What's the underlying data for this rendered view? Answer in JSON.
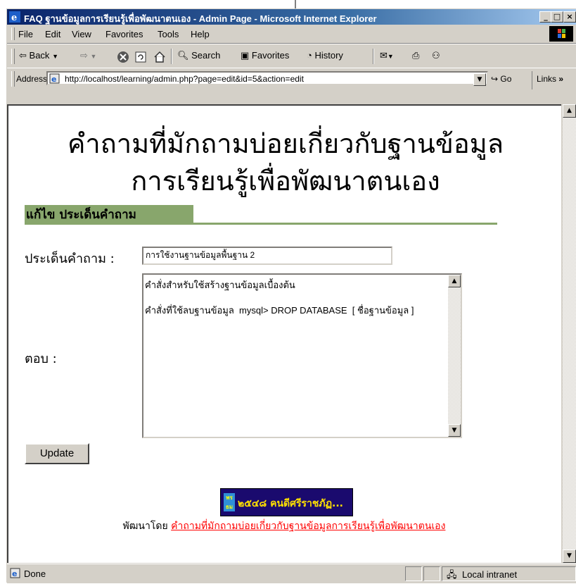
{
  "window": {
    "title": "FAQ ฐานข้อมูลการเรียนรู้เพื่อพัฒนาตนเอง - Admin Page - Microsoft Internet Explorer",
    "buttons": [
      "_",
      "□",
      "×"
    ]
  },
  "menu": {
    "items": [
      "File",
      "Edit",
      "View",
      "Favorites",
      "Tools",
      "Help"
    ]
  },
  "toolbar": {
    "back": "Back",
    "search": "Search",
    "favorites": "Favorites",
    "history": "History"
  },
  "address": {
    "label": "Address",
    "url": "http://localhost/learning/admin.php?page=edit&id=5&action=edit",
    "go": "Go",
    "links": "Links"
  },
  "page": {
    "title_line1": "คำถามที่มักถามบ่อยเกี่ยวกับฐานข้อมูล",
    "title_line2": "การเรียนรู้เพื่อพัฒนาตนเอง",
    "section": "แก้ไข ประเด็นคำถาม",
    "topic_label": "ประเด็นคำถาม :",
    "topic_value": "การใช้งานฐานข้อมูลพื้นฐาน 2",
    "answer_label": "ตอบ :",
    "answer_value": "คำสั่งสำหรับใช้สร้างฐานข้อมูลเบื้องต้น\n\nคำสั่งที่ใช้ลบฐานข้อมูล  mysql> DROP DATABASE  [ ชื่อฐานข้อมูล ]",
    "update_button": "Update",
    "banner_text": "๒๕๔๘ คนดีศรีราชภัฏ...",
    "banner_logo": "พร ธม",
    "footer_prefix": "พัฒนาโดย",
    "footer_link": "คำถามที่มักถามบ่อยเกี่ยวกับฐานข้อมูลการเรียนรู้เพื่อพัฒนาตนเอง"
  },
  "status": {
    "left": "Done",
    "zone": "Local intranet"
  }
}
